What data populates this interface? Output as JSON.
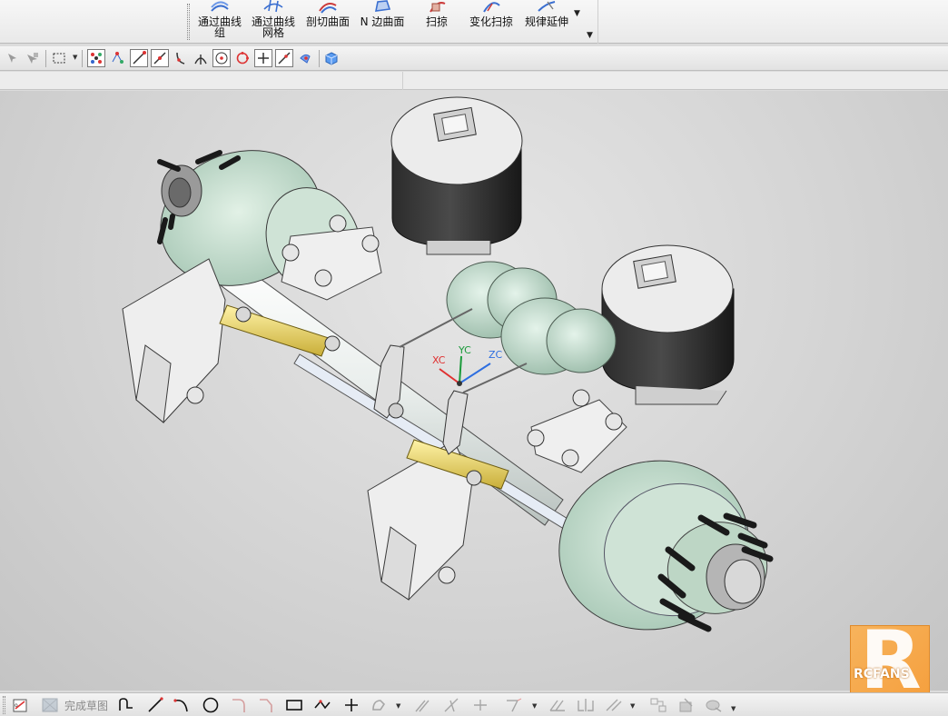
{
  "ribbon": {
    "buttons": [
      {
        "label": "通过曲线\n组",
        "icon": "through-curves-icon"
      },
      {
        "label": "通过曲线\n网格",
        "icon": "curve-mesh-icon"
      },
      {
        "label": "剖切曲面",
        "icon": "section-surface-icon"
      },
      {
        "label": "N 边曲面",
        "icon": "n-sided-surface-icon"
      },
      {
        "label": "扫掠",
        "icon": "swept-icon"
      },
      {
        "label": "变化扫掠",
        "icon": "variational-sweep-icon"
      },
      {
        "label": "规律延伸",
        "icon": "law-extension-icon"
      }
    ]
  },
  "selection_toolbar": {
    "icons": [
      "select-filter-icon",
      "select-type-icon",
      "rectangle-select-icon",
      "snap-all-icon",
      "snap-control-point-icon",
      "snap-end-point-icon",
      "snap-mid-point-icon",
      "snap-tangent-icon",
      "snap-intersection-icon",
      "snap-arc-center-icon",
      "snap-quadrant-icon",
      "snap-existing-point-icon",
      "snap-on-curve-icon",
      "snap-on-surface-icon",
      "view-cube-icon"
    ]
  },
  "viewport": {
    "axes": {
      "x": "XC",
      "y": "YC",
      "z": "ZC"
    },
    "colors": {
      "x": "#e03030",
      "y": "#1a9a3a",
      "z": "#2d6ee0"
    },
    "model": "trailer-axle-air-suspension-assembly"
  },
  "watermark": {
    "text": "RCFANS",
    "letter": "R"
  },
  "sketch_toolbar": {
    "finish_label": "完成草图",
    "icons": [
      "sketch-icon",
      "finish-sketch-icon",
      "profile-icon",
      "line-icon",
      "arc-icon",
      "circle-icon",
      "fillet-icon",
      "chamfer-icon",
      "rectangle-icon",
      "polygon-icon",
      "point-icon",
      "studio-spline-icon",
      "offset-curve-icon",
      "quick-trim-icon",
      "quick-extend-icon",
      "make-corner-icon",
      "derived-lines-icon",
      "mirror-curve-icon",
      "constraints-icon",
      "auto-constrain-icon",
      "show-constraints-icon",
      "relations-icon",
      "alternate-solution-icon"
    ]
  }
}
